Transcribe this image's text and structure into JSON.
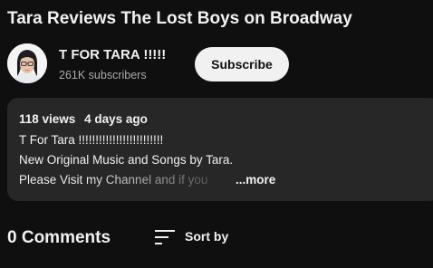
{
  "video": {
    "title": "Tara Reviews The Lost Boys on Broadway"
  },
  "channel": {
    "name": "T FOR TARA !!!!!",
    "subscribers": "261K subscribers",
    "subscribe_label": "Subscribe"
  },
  "description": {
    "views": "118 views",
    "age": "4 days ago",
    "lines": [
      "T For Tara !!!!!!!!!!!!!!!!!!!!!!!!!",
      "New Original Music and Songs by Tara.",
      "Please Visit my Channel and if you"
    ],
    "more_label": "...more"
  },
  "comments": {
    "count_label": "0 Comments",
    "sort_label": "Sort by"
  },
  "colors": {
    "background": "#0f0f0f",
    "panel": "#272727",
    "text_primary": "#f1f1f1",
    "text_secondary": "#aaaaaa",
    "button_bg": "#f1f1f1"
  },
  "icons": {
    "avatar": "channel-avatar",
    "sort": "sort-icon"
  }
}
